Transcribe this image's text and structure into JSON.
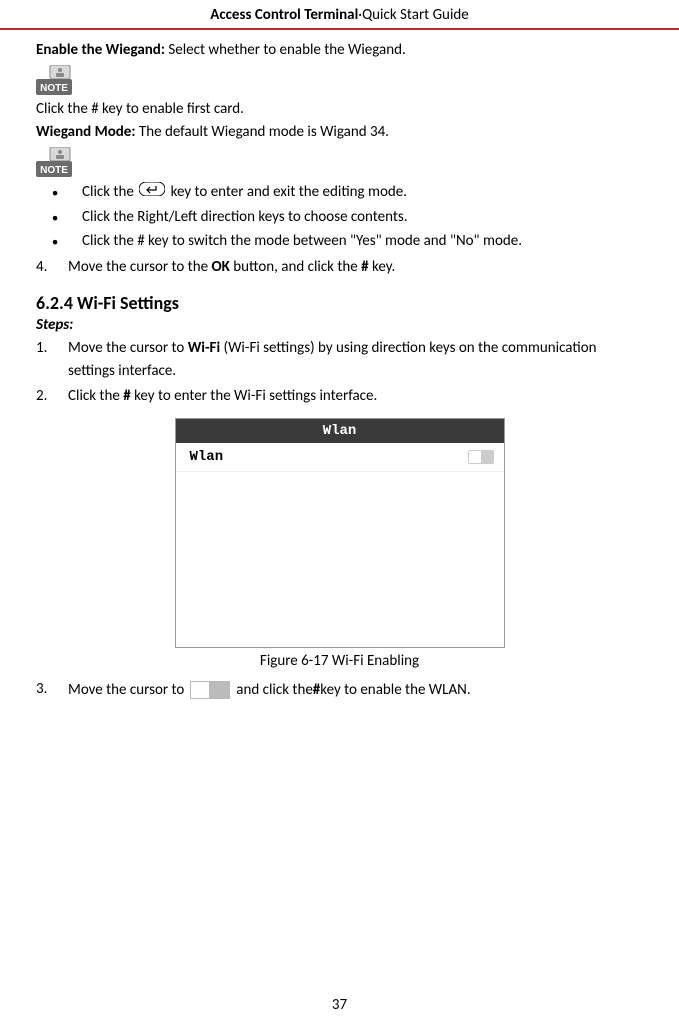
{
  "header": {
    "bold": "Access Control Terminal",
    "sep": "·",
    "rest": "Quick Start Guide"
  },
  "enable_wiegand": {
    "label": "Enable the Wiegand:",
    "text": "Select whether to enable the Wiegand."
  },
  "note_enable": "Click the # key to enable first card.",
  "wiegand_mode": {
    "label": "Wiegand Mode:",
    "text": "The default Wiegand mode is Wigand 34."
  },
  "bullets": [
    {
      "pre": "Click the",
      "post": "key to enter and exit the editing mode."
    },
    {
      "text": "Click the Right/Left direction keys to choose contents."
    },
    {
      "text": "Click the # key to switch the mode between \"Yes\" mode and \"No\" mode."
    }
  ],
  "step4": {
    "num": "4.",
    "pre": "Move the cursor to the ",
    "bold": "OK",
    "mid": " button, and click the ",
    "bold2": "#",
    "post": " key."
  },
  "section": "6.2.4 Wi-Fi Settings",
  "steps_label": "Steps:",
  "wifi_steps": {
    "s1": {
      "num": "1.",
      "pre": "Move the cursor to ",
      "bold": "Wi-Fi",
      "post": " (Wi-Fi settings) by using direction keys on the communication settings interface."
    },
    "s2": {
      "num": "2.",
      "pre": "Click the ",
      "bold": "#",
      "post": " key to enter the Wi-Fi settings interface."
    },
    "s3": {
      "num": "3.",
      "pre": "Move the cursor to",
      "mid": "and click the ",
      "bold": "#",
      "post": " key to enable the WLAN."
    }
  },
  "wifi_window": {
    "title": "Wlan",
    "row_label": "Wlan"
  },
  "figure_caption": "Figure 6-17 Wi-Fi Enabling",
  "page_number": "37"
}
